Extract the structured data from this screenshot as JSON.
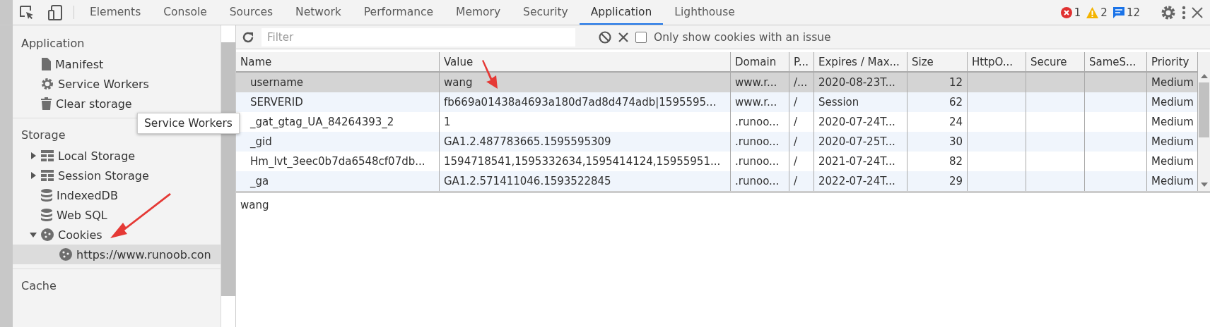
{
  "toolbar": {
    "tabs": [
      {
        "label": "Elements",
        "selected": false
      },
      {
        "label": "Console",
        "selected": false
      },
      {
        "label": "Sources",
        "selected": false
      },
      {
        "label": "Network",
        "selected": false
      },
      {
        "label": "Performance",
        "selected": false
      },
      {
        "label": "Memory",
        "selected": false
      },
      {
        "label": "Security",
        "selected": false
      },
      {
        "label": "Application",
        "selected": true
      },
      {
        "label": "Lighthouse",
        "selected": false
      }
    ],
    "counters": [
      {
        "kind": "error",
        "count": "1"
      },
      {
        "kind": "warning",
        "count": "2"
      },
      {
        "kind": "info",
        "count": "12"
      }
    ]
  },
  "sidebar": {
    "sections": [
      {
        "title": "Application",
        "items": [
          {
            "label": "Manifest",
            "kind": "file",
            "selected": false
          },
          {
            "label": "Service Workers",
            "kind": "gear",
            "selected": false
          },
          {
            "label": "Clear storage",
            "kind": "trash",
            "selected": false
          }
        ]
      },
      {
        "title": "Storage",
        "items": [
          {
            "label": "Local Storage",
            "kind": "grid",
            "expanded": false,
            "selected": false
          },
          {
            "label": "Session Storage",
            "kind": "grid",
            "expanded": false,
            "selected": false
          },
          {
            "label": "IndexedDB",
            "kind": "db",
            "selected": false
          },
          {
            "label": "Web SQL",
            "kind": "db",
            "selected": false
          },
          {
            "label": "Cookies",
            "kind": "cookie",
            "expanded": true,
            "selected": false,
            "children": [
              {
                "label": "https://www.runoob.con",
                "kind": "cookie",
                "selected": true
              }
            ]
          }
        ]
      },
      {
        "title": "Cache"
      }
    ]
  },
  "tooltip": "Service Workers",
  "filter_bar": {
    "placeholder": "Filter",
    "checkbox": {
      "label": "Only show cookies with an issue",
      "checked": false
    }
  },
  "table": {
    "columns": [
      "Name",
      "Value",
      "Domain",
      "P...",
      "Expires / Max...",
      "Size",
      "HttpO...",
      "Secure",
      "SameS...",
      "Priority"
    ],
    "rows": [
      {
        "selected": true,
        "cells": [
          "username",
          "wang",
          "www.r...",
          "/...",
          "2020-08-23T...",
          "12",
          "",
          "",
          "",
          "Medium"
        ]
      },
      {
        "selected": false,
        "cells": [
          "SERVERID",
          "fb669a01438a4693a180d7ad8d474adb|1595595...",
          "www.r...",
          "/",
          "Session",
          "62",
          "",
          "",
          "",
          "Medium"
        ]
      },
      {
        "selected": false,
        "cells": [
          "_gat_gtag_UA_84264393_2",
          "1",
          ".runoo...",
          "/",
          "2020-07-24T...",
          "24",
          "",
          "",
          "",
          "Medium"
        ]
      },
      {
        "selected": false,
        "cells": [
          "_gid",
          "GA1.2.487783665.1595595309",
          ".runoo...",
          "/",
          "2020-07-25T...",
          "30",
          "",
          "",
          "",
          "Medium"
        ]
      },
      {
        "selected": false,
        "cells": [
          "Hm_lvt_3eec0b7da6548cf07db...",
          "1594718541,1595332634,1595414124,15955951...",
          ".runoo...",
          "/",
          "2021-07-24T...",
          "82",
          "",
          "",
          "",
          "Medium"
        ]
      },
      {
        "selected": false,
        "cells": [
          "_ga",
          "GA1.2.571411046.1593522845",
          ".runoo...",
          "/",
          "2022-07-24T...",
          "29",
          "",
          "",
          "",
          "Medium"
        ]
      }
    ]
  },
  "preview": "wang"
}
